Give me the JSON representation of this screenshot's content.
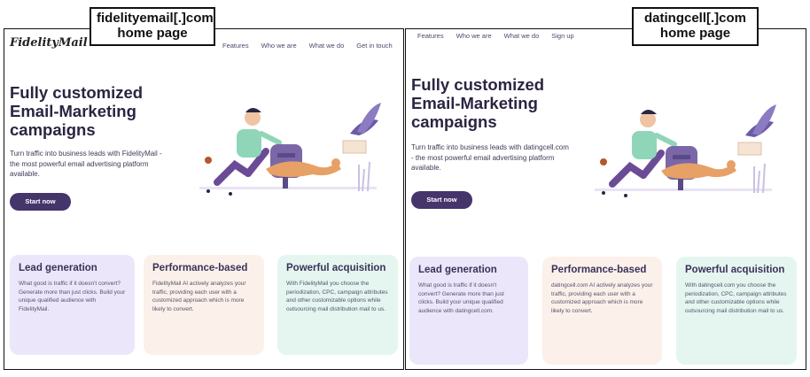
{
  "captions": {
    "left_line1": "fidelityemail[.]com",
    "left_line2": "home page",
    "right_line1": "datingcell[.]com",
    "right_line2": "home page"
  },
  "left": {
    "logo": "FidelityMail",
    "nav": [
      "Features",
      "Who we are",
      "What we do",
      "Get in touch"
    ],
    "hero_title_lines": [
      "Fully customized",
      "Email-Marketing",
      "campaigns"
    ],
    "hero_sub": "Turn traffic into business leads with FidelityMail - the most powerful email advertising platform available.",
    "cta": "Start now",
    "cards": [
      {
        "title": "Lead generation",
        "body": "What good is traffic if it doesn't convert? Generate more than just clicks. Build your unique qualified audience with FidelityMail."
      },
      {
        "title": "Performance-based",
        "body": "FidelityMail AI actively analyzes your traffic, providing each user with a customized approach which is more likely to convert."
      },
      {
        "title": "Powerful acquisition",
        "body": "With FidelityMail you choose the periodization, CPC, campaign attributes and other customizable options while outsourcing mail distribution mail to us."
      }
    ]
  },
  "right": {
    "nav": [
      "Features",
      "Who we are",
      "What we do",
      "Sign up"
    ],
    "hero_title_lines": [
      "Fully customized",
      "Email-Marketing",
      "campaigns"
    ],
    "hero_sub": "Turn traffic into business leads with datingcell.com - the most powerful email advertising platform available.",
    "cta": "Start now",
    "cards": [
      {
        "title": "Lead generation",
        "body": "What good is traffic if it doesn't convert? Generate more than just clicks. Build your unique qualified audience with datingcell.com."
      },
      {
        "title": "Performance-based",
        "body": "datingcell.com AI actively analyzes your traffic, providing each user with a customized approach which is more likely to convert."
      },
      {
        "title": "Powerful acquisition",
        "body": "With datingcell.com you choose the periodization, CPC, campaign attributes and other customizable options while outsourcing mail distribution mail to us."
      }
    ]
  },
  "colors": {
    "accent": "#45356b",
    "card_lead": "#ece6fb",
    "card_perf": "#fbf1ea",
    "card_acq": "#e4f6ef"
  },
  "icons": [
    "running-man-mailbox-dog-bird-illustration"
  ]
}
